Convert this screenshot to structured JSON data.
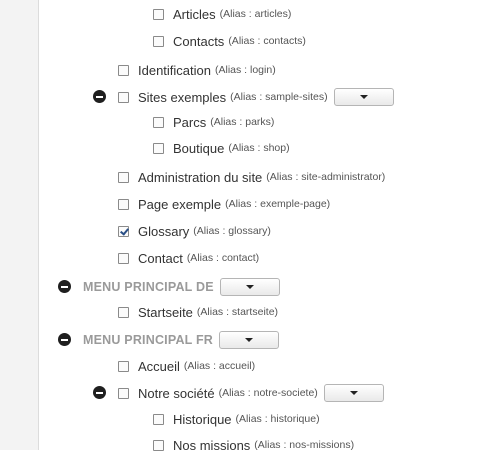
{
  "items": {
    "articles": {
      "label": "Articles",
      "alias": "(Alias : articles)",
      "checked": false
    },
    "contacts": {
      "label": "Contacts",
      "alias": "(Alias : contacts)",
      "checked": false
    },
    "identification": {
      "label": "Identification",
      "alias": "(Alias : login)",
      "checked": false
    },
    "sites_exemples": {
      "label": "Sites exemples",
      "alias": "(Alias : sample-sites)",
      "checked": false
    },
    "parcs": {
      "label": "Parcs",
      "alias": "(Alias : parks)",
      "checked": false
    },
    "boutique": {
      "label": "Boutique",
      "alias": "(Alias : shop)",
      "checked": false
    },
    "administration": {
      "label": "Administration du site",
      "alias": "(Alias : site-administrator)",
      "checked": false
    },
    "page_exemple": {
      "label": "Page exemple",
      "alias": "(Alias : exemple-page)",
      "checked": false
    },
    "glossary": {
      "label": "Glossary",
      "alias": "(Alias : glossary)",
      "checked": true
    },
    "contact": {
      "label": "Contact",
      "alias": "(Alias : contact)",
      "checked": false
    },
    "startseite": {
      "label": "Startseite",
      "alias": "(Alias : startseite)",
      "checked": false
    },
    "accueil": {
      "label": "Accueil",
      "alias": "(Alias : accueil)",
      "checked": false
    },
    "notre_societe": {
      "label": "Notre société",
      "alias": "(Alias : notre-societe)",
      "checked": false
    },
    "historique": {
      "label": "Historique",
      "alias": "(Alias : historique)",
      "checked": false
    },
    "nos_missions": {
      "label": "Nos missions",
      "alias": "(Alias : nos-missions)",
      "checked": false
    }
  },
  "menus": {
    "de": {
      "title": "MENU PRINCIPAL DE"
    },
    "fr": {
      "title": "MENU PRINCIPAL FR"
    }
  },
  "icons": {
    "collapse": "minus-circle-icon",
    "dropdown": "caret-down-icon"
  },
  "colors": {
    "menu_heading": "#9a9a9a",
    "gutter": "#f3f3f3",
    "collapse_icon": "#1f1f1f"
  }
}
